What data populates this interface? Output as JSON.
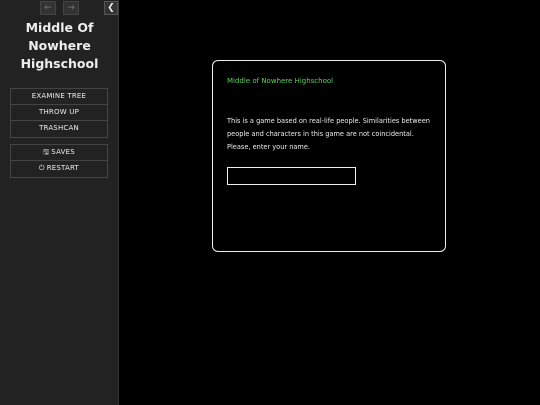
{
  "sidebar": {
    "story_title": "Middle Of Nowhere Highschool",
    "history_back_icon": "left-arrow-icon",
    "history_forward_icon": "right-arrow-icon",
    "collapse_icon": "chevron-left-icon",
    "actions": [
      {
        "label": "EXAMINE TREE"
      },
      {
        "label": "THROW UP"
      },
      {
        "label": "TRASHCAN"
      }
    ],
    "system": [
      {
        "label": "SAVES",
        "icon": "floppy-disk-icon"
      },
      {
        "label": "RESTART",
        "icon": "power-icon"
      }
    ]
  },
  "passage": {
    "heading": "Middle of Nowhere Highschool",
    "body": "This is a game based on real-life people. Similarities between people and characters in this game are not coincidental. Please, enter your name.",
    "name_input_value": "",
    "heading_color": "#5bd35b"
  }
}
